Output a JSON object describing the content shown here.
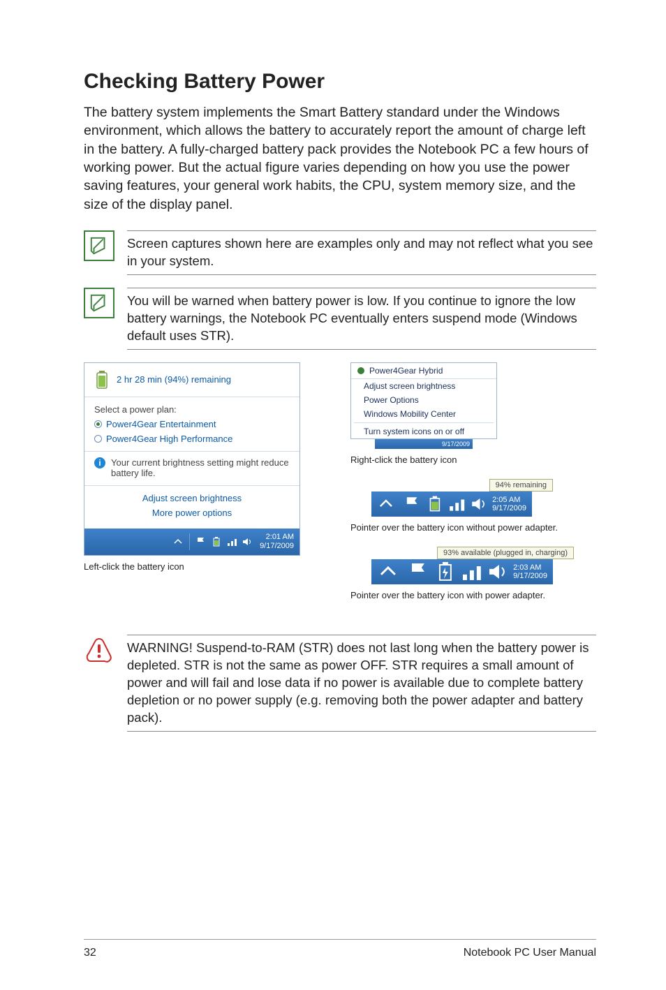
{
  "heading": "Checking Battery Power",
  "intro": "The battery system implements the Smart Battery standard under the Windows environment, which allows the battery to accurately report the amount of charge left in the battery. A fully-charged battery pack provides the Notebook PC a few hours of working power. But the actual figure varies depending on how you use the power saving features, your general work habits, the CPU, system memory size, and the size of the display panel.",
  "note1": "Screen captures shown here are examples only and may not reflect what you see in your system.",
  "note2": "You will be warned when battery power is low. If you continue to ignore the low battery warnings, the Notebook PC eventually enters suspend mode (Windows default uses STR).",
  "popup": {
    "remaining": "2 hr 28 min (94%) remaining",
    "plans_header": "Select a power plan:",
    "plan1": "Power4Gear Entertainment",
    "plan2": "Power4Gear High Performance",
    "info": "Your current brightness setting might reduce battery life.",
    "link1": "Adjust screen brightness",
    "link2": "More power options"
  },
  "tray_left": {
    "time": "2:01 AM",
    "date": "9/17/2009"
  },
  "caption_left": "Left-click the battery icon",
  "ctx": {
    "title": "Power4Gear Hybrid",
    "item1": "Adjust screen brightness",
    "item2": "Power Options",
    "item3": "Windows Mobility Center",
    "item4": "Turn system icons on or off"
  },
  "ctx_date": "9/17/2009",
  "caption_ctx": "Right-click the battery icon",
  "tooltip1": "94% remaining",
  "tray_r1": {
    "time": "2:05 AM",
    "date": "9/17/2009"
  },
  "caption_r1": "Pointer over the battery icon without power adapter.",
  "tooltip2": "93% available (plugged in, charging)",
  "tray_r2": {
    "time": "2:03 AM",
    "date": "9/17/2009"
  },
  "caption_r2": "Pointer over the battery icon with power adapter.",
  "warning": "WARNING!  Suspend-to-RAM (STR) does not last long when the battery power is depleted. STR is not the same as power OFF. STR requires a small amount of power and will fail and lose data if no power is available due to complete battery depletion or no power supply (e.g. removing both the power adapter and battery pack).",
  "footer": {
    "page": "32",
    "title": "Notebook PC User Manual"
  }
}
